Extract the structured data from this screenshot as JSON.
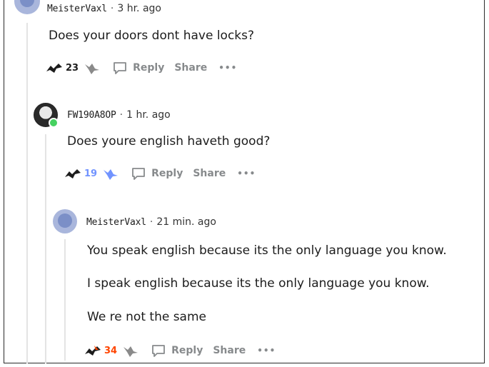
{
  "comments": [
    {
      "username": "MeisterVaxl",
      "separator": "·",
      "time": "3 hr. ago",
      "body": [
        "Does your doors dont have locks?"
      ],
      "score": "23",
      "score_color": "#1c1c1c",
      "upvote_color": "#1c1c1c",
      "avatar": "snoo-avatar"
    },
    {
      "username": "FW190A8OP",
      "separator": "·",
      "time": "1 hr. ago",
      "body": [
        "Does youre english haveth good?"
      ],
      "score": "19",
      "score_color": "#7193ff",
      "upvote_color": "#7193ff",
      "avatar": "photo-avatar"
    },
    {
      "username": "MeisterVaxl",
      "separator": "·",
      "time": "21 min. ago",
      "body": [
        "You speak english because its the only language you know.",
        "I speak english because its the only language you know.",
        "We re not the same"
      ],
      "score": "34",
      "score_color": "#ff4500",
      "upvote_color": "#ff4500",
      "avatar": "snoo-avatar"
    }
  ],
  "actions": {
    "reply_label": "Reply",
    "share_label": "Share",
    "more_label": "•••"
  },
  "icons": {
    "upvote": "upvote-arrow-icon",
    "downvote": "downvote-arrow-icon",
    "reply": "speech-bubble-icon",
    "more": "ellipsis-icon"
  }
}
